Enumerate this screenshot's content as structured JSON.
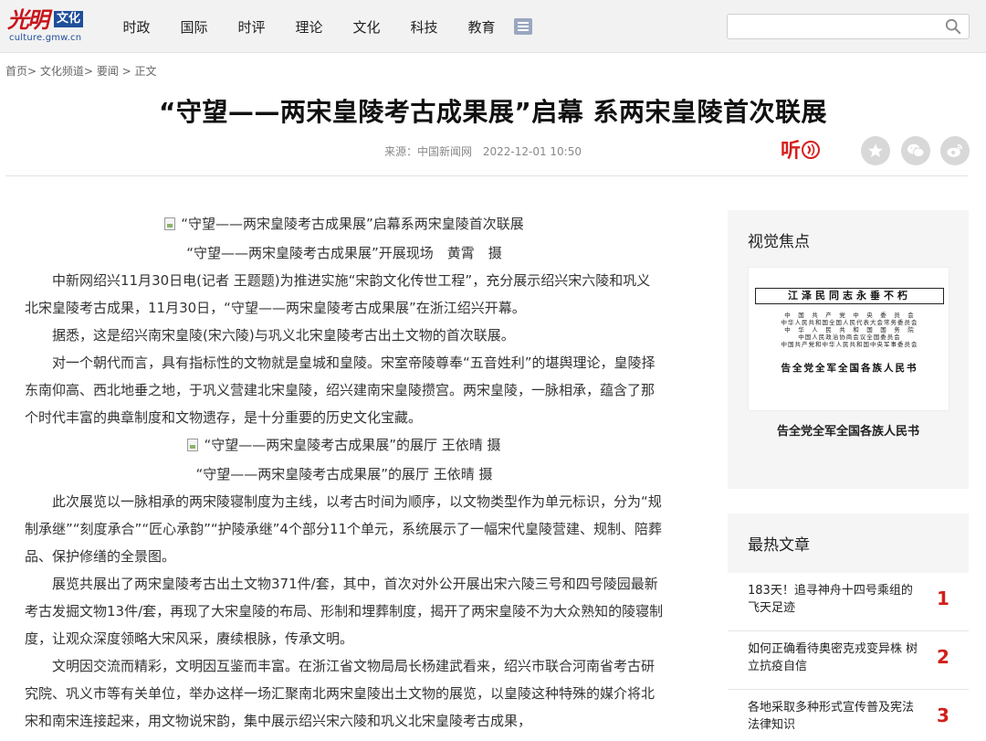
{
  "header": {
    "logo_script": "光明",
    "logo_box": "文化",
    "logo_url": "culture.gmw.cn",
    "nav": [
      "时政",
      "国际",
      "时评",
      "理论",
      "文化",
      "科技",
      "教育"
    ],
    "search_value": "",
    "search_icon": "magnifier-icon",
    "menu_icon": "list-menu-icon"
  },
  "breadcrumb": [
    {
      "label": "首页",
      "sep": ">"
    },
    {
      "label": "文化频道",
      "sep": ">"
    },
    {
      "label": "要闻",
      "sep": " > "
    },
    {
      "label": "正文",
      "sep": ""
    }
  ],
  "article": {
    "title": "“守望——两宋皇陵考古成果展”启幕 系两宋皇陵首次联展",
    "source": "来源：中国新闻网",
    "time": "2022-12-01 10:50",
    "listen_label": "听",
    "img1_alt": "“守望——两宋皇陵考古成果展”启幕系两宋皇陵首次联展",
    "img1_caption": "“守望——两宋皇陵考古成果展”开展现场　黄霄　摄",
    "para1": "中新网绍兴11月30日电(记者 王题题)为推进实施“宋韵文化传世工程”，充分展示绍兴宋六陵和巩义北宋皇陵考古成果，11月30日，“守望——两宋皇陵考古成果展”在浙江绍兴开幕。",
    "para2": "据悉，这是绍兴南宋皇陵(宋六陵)与巩义北宋皇陵考古出土文物的首次联展。",
    "para3": "对一个朝代而言，具有指标性的文物就是皇城和皇陵。宋室帝陵尊奉“五音姓利”的堪舆理论，皇陵择东南仰高、西北地垂之地，于巩义营建北宋皇陵，绍兴建南宋皇陵攒宫。两宋皇陵，一脉相承，蕴含了那个时代丰富的典章制度和文物遗存，是十分重要的历史文化宝藏。",
    "img2_alt": "“守望——两宋皇陵考古成果展”的展厅 王依晴 摄",
    "img2_caption": "“守望——两宋皇陵考古成果展”的展厅 王依晴 摄",
    "para4": "此次展览以一脉相承的两宋陵寝制度为主线，以考古时间为顺序，以文物类型作为单元标识，分为“规制承继”“刻度承合”“匠心承韵”“护陵承继”4个部分11个单元，系统展示了一幅宋代皇陵营建、规制、陪葬品、保护修缮的全景图。",
    "para5": "展览共展出了两宋皇陵考古出土文物371件/套，其中，首次对外公开展出宋六陵三号和四号陵园最新考古发掘文物13件/套，再现了大宋皇陵的布局、形制和埋葬制度，揭开了两宋皇陵不为大众熟知的陵寝制度，让观众深度领略大宋风采，赓续根脉，传承文明。",
    "para6": "文明因交流而精彩，文明因互鉴而丰富。在浙江省文物局局长杨建武看来，绍兴市联合河南省考古研究院、巩义市等有关单位，举办这样一场汇聚南北两宋皇陵出土文物的展览，以皇陵这种特殊的媒介将北宋和南宋连接起来，用文物说宋韵，集中展示绍兴宋六陵和巩义北宋皇陵考古成果，"
  },
  "sidebar": {
    "focus_title": "视觉焦点",
    "focus_image": {
      "head": "江泽民同志永垂不朽",
      "lines": [
        "中　国　共　产　党　中　央　委　员　会",
        "中华人民共和国全国人民代表大会常务委员会",
        "中　华　人　民　共　和　国　国　务　院",
        "中国人民政治协商会议全国委员会",
        "中国共产党和中华人民共和国中央军事委员会"
      ],
      "main": "告全党全军全国各族人民书"
    },
    "focus_caption": "告全党全军全国各族人民书",
    "hot_title": "最热文章",
    "hot_items": [
      {
        "text": "183天！追寻神舟十四号乘组的飞天足迹",
        "rank": "1"
      },
      {
        "text": "如何正确看待奥密克戎变异株 树立抗疫自信",
        "rank": "2"
      },
      {
        "text": "各地采取多种形式宣传普及宪法法律知识",
        "rank": "3"
      }
    ]
  },
  "colors": {
    "accent": "#d1201a",
    "nav_bg": "#f2f2f2",
    "brand_blue": "#1f4e9a"
  }
}
